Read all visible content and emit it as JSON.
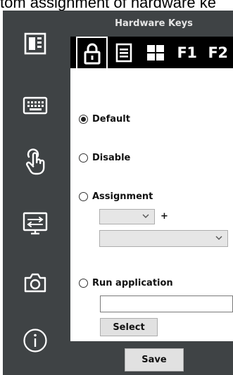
{
  "caption": "tom assignment of hardware ke",
  "panel": {
    "title": "Hardware Keys"
  },
  "sidebar": {
    "items": [
      {
        "icon": "device-layout-icon"
      },
      {
        "icon": "keyboard-icon"
      },
      {
        "icon": "touch-icon"
      },
      {
        "icon": "display-input-icon"
      },
      {
        "icon": "camera-icon"
      },
      {
        "icon": "info-icon"
      }
    ]
  },
  "tabs": [
    {
      "icon": "lock-icon",
      "label": ""
    },
    {
      "icon": "menu-icon",
      "label": ""
    },
    {
      "icon": "windows-icon",
      "label": ""
    },
    {
      "icon": "",
      "label": "F1"
    },
    {
      "icon": "",
      "label": "F2"
    }
  ],
  "options": {
    "default_label": "Default",
    "disable_label": "Disable",
    "assignment_label": "Assignment",
    "run_app_label": "Run application",
    "selected": "default"
  },
  "assignment": {
    "plus": "+",
    "modifier_value": "",
    "key_value": ""
  },
  "run_app": {
    "path_value": "",
    "select_label": "Select"
  },
  "footer": {
    "save_label": "Save"
  },
  "colors": {
    "sidebar_bg": "#3f4345",
    "tabbar_bg": "#000000",
    "icon": "#ffffff"
  }
}
